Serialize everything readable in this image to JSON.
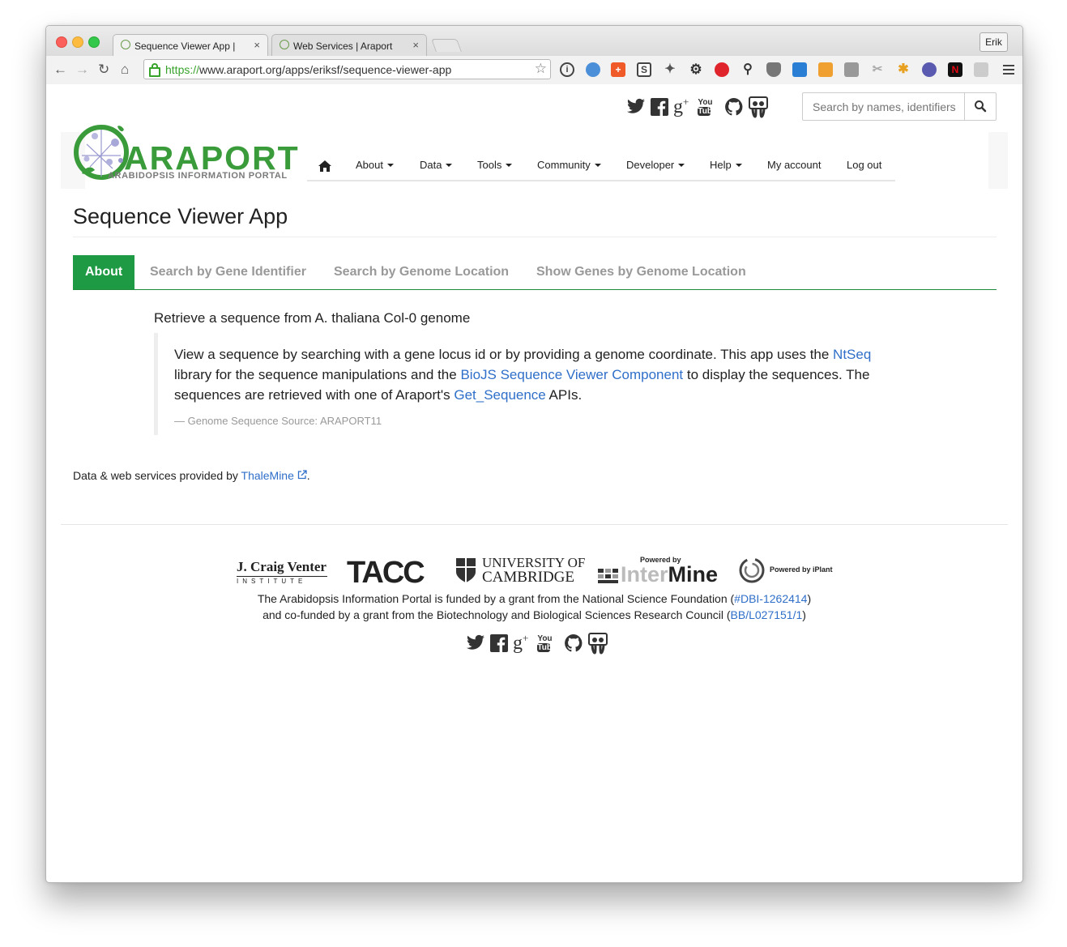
{
  "browser": {
    "tabs": [
      {
        "title": "Sequence Viewer App | Araport",
        "close": "×"
      },
      {
        "title": "Web Services | Araport",
        "close": "×"
      }
    ],
    "profile": "Erik",
    "url_scheme": "https://",
    "url_rest": "www.araport.org/apps/eriksf/sequence-viewer-app"
  },
  "header": {
    "search_placeholder": "Search by names, identifiers",
    "logo_word": "ARAPORT",
    "logo_sub": "ARABIDOPSIS INFORMATION PORTAL",
    "social": [
      "twitter-icon",
      "facebook-icon",
      "google-plus-icon",
      "youtube-icon",
      "github-icon",
      "slideshare-icon"
    ]
  },
  "nav": {
    "items": [
      "About",
      "Data",
      "Tools",
      "Community",
      "Developer",
      "Help",
      "My account",
      "Log out"
    ]
  },
  "page": {
    "title": "Sequence Viewer App",
    "tabs": [
      "About",
      "Search by Gene Identifier",
      "Search by Genome Location",
      "Show Genes by Genome Location"
    ],
    "section_heading": "Retrieve a sequence from A. thaliana Col-0 genome",
    "desc_part1": "View a sequence by searching with a gene locus id or by providing a genome coordinate. This app uses the ",
    "desc_link1": "NtSeq",
    "desc_part2": " library for the sequence manipulations and the ",
    "desc_link2": "BioJS Sequence Viewer Component",
    "desc_part3": " to display the sequences. The sequences are retrieved with one of Araport's ",
    "desc_link3": "Get_Sequence",
    "desc_part4": " APIs.",
    "source": "— Genome Sequence Source: ARAPORT11",
    "provided_prefix": "Data & web services provided by ",
    "provided_link": "ThaleMine",
    "provided_suffix": "."
  },
  "footer": {
    "logos": {
      "jcvi_line1": "J. Craig Venter",
      "jcvi_line2": "INSTITUTE",
      "tacc": "TACC",
      "cambridge_line1": "UNIVERSITY OF",
      "cambridge_line2": "CAMBRIDGE",
      "intermine_powered": "Powered by",
      "intermine_inter": "Inter",
      "intermine_mine": "Mine",
      "iplant": "Powered by iPlant"
    },
    "fund1_text": "The Arabidopsis Information Portal is funded by a grant from the National Science Foundation (",
    "fund1_link": "#DBI-1262414",
    "fund1_close": ")",
    "fund2_text": "and co-funded by a grant from the Biotechnology and Biological Sciences Research Council (",
    "fund2_link": "BB/L027151/1",
    "fund2_close": ")"
  },
  "colors": {
    "brand_green": "#3a9b3a",
    "tab_active": "#1e9a44",
    "link": "#2f6fc9"
  }
}
